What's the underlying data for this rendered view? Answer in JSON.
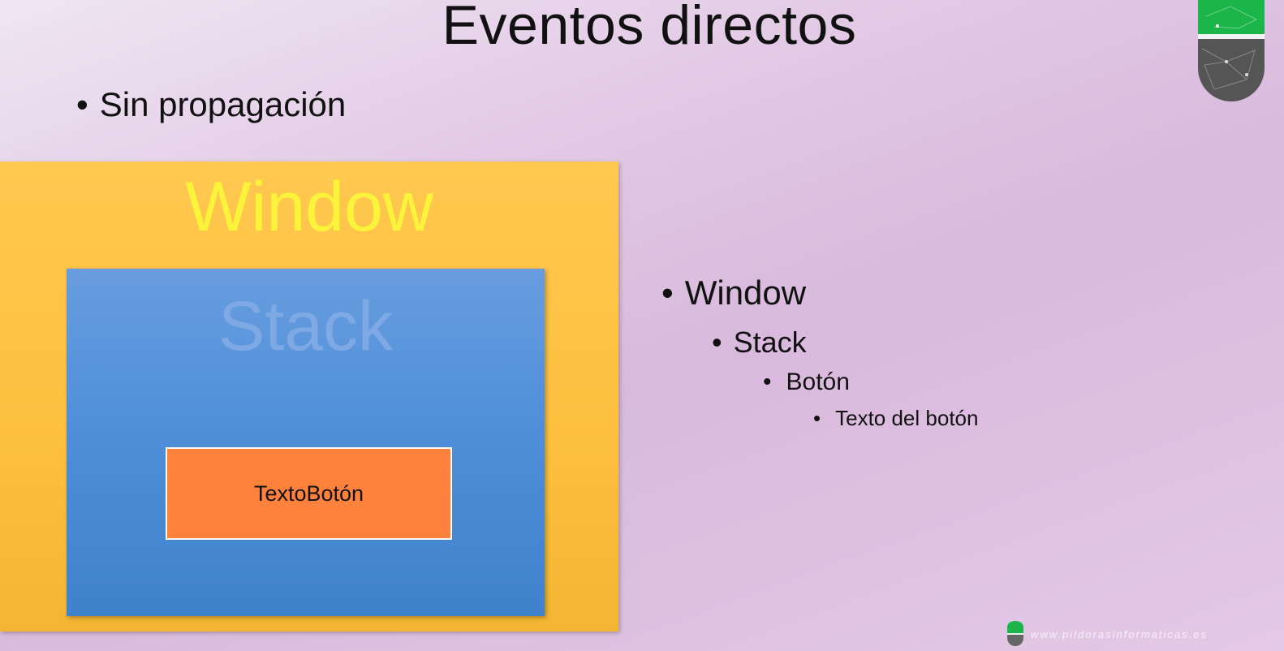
{
  "slide": {
    "title": "Eventos directos",
    "main_bullet": "Sin propagación"
  },
  "diagram": {
    "window_label": "Window",
    "stack_label": "Stack",
    "button_label": "TextoBotón",
    "colors": {
      "window": "#fec03f",
      "window_text": "#fbf43a",
      "stack": "#4f8fd9",
      "stack_text": "#7ea9e4",
      "button": "#ff823c"
    }
  },
  "tree": {
    "level1": "Window",
    "level2": "Stack",
    "level3": "Botón",
    "level4": "Texto del botón"
  },
  "branding": {
    "badge_icon": "pildoras-badge-icon",
    "footer_url": "www.pildorasinformaticas.es"
  }
}
